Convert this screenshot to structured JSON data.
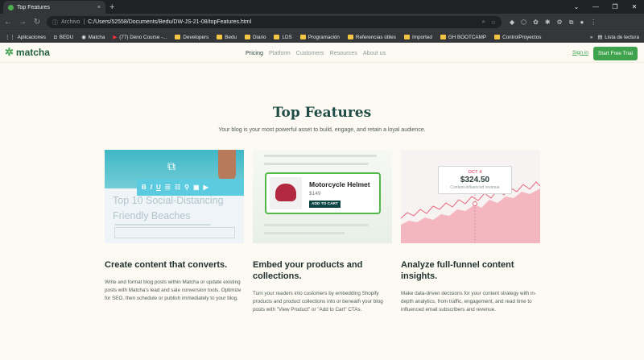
{
  "browser": {
    "tab_title": "Top Features",
    "tab_close": "×",
    "new_tab": "+",
    "window_controls": [
      "⌄",
      "—",
      "❐",
      "✕"
    ],
    "address_label": "Archivo",
    "address_path": "C:/Users/52558/Documents/Bedu/DW-JS-21-08/topFeatures.html",
    "bookmarks": [
      "Aplicaciones",
      "BEDU",
      "Matcha",
      "(77) Deno Course -...",
      "Developers",
      "Bedu",
      "Diario",
      "LDS",
      "Programación",
      "Referencias útiles",
      "Imported",
      "GH BOOTCAMP",
      "ControlProyectos"
    ],
    "bookmarks_more": "»",
    "reading_list": "Lista de lectura"
  },
  "site": {
    "logo": "matcha",
    "nav": [
      "Pricing",
      "Platform",
      "Customers",
      "Resources",
      "About us"
    ],
    "signin": "Sign in",
    "cta": "Start Free Trial"
  },
  "hero": {
    "title": "Top Features",
    "subtitle": "Your blog is your most powerful asset to build, engage, and retain a loyal audience."
  },
  "cards": [
    {
      "headline": "Top 10 Social-Distancing Friendly Beaches",
      "title": "Create content that converts.",
      "text": "Write and format blog posts within Matcha or update existing posts with Matcha's lead and sale conversion tools. Optimize for SEO, then schedule or publish immediately to your blog."
    },
    {
      "product_name": "Motorcycle Helmet",
      "product_price": "$149",
      "product_button": "ADD TO CART",
      "title": "Embed your products and collections.",
      "text": "Turn your readers into customers by embedding Shopify products and product collections into or beneath your blog posts with \"View Product\" or \"Add to Cart\" CTAs."
    },
    {
      "tooltip_date": "OCT 4",
      "tooltip_value": "$324.50",
      "tooltip_label": "Content-influenced revenue",
      "title": "Analyze full-funnel content insights.",
      "text": "Make data-driven decisions for your content strategy with in-depth analytics, from traffic, engagement, and read time to influenced email subscribers and revenue."
    }
  ],
  "colors": {
    "accent": "#3fa34d",
    "heading": "#1f4c47",
    "chart": "#e5677c"
  }
}
